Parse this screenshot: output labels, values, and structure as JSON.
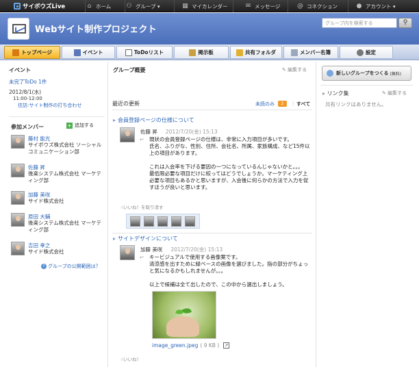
{
  "topbar": {
    "logo": "サイボウズLive",
    "nav": [
      {
        "label": "ホーム",
        "icon": "home-icon"
      },
      {
        "label": "グループ ▾",
        "icon": "group-icon"
      },
      {
        "label": "マイカレンダー",
        "icon": "calendar-icon"
      },
      {
        "label": "メッセージ",
        "icon": "message-icon"
      },
      {
        "label": "コネクション",
        "icon": "at-icon"
      },
      {
        "label": "アカウント ▾",
        "icon": "account-icon"
      }
    ]
  },
  "header": {
    "title": "Webサイト制作プロジェクト",
    "search_placeholder": "グループ内を検索する"
  },
  "tabs": [
    {
      "label": "トップページ",
      "active": true
    },
    {
      "label": "イベント"
    },
    {
      "label": "ToDoリスト"
    },
    {
      "label": "掲示板"
    },
    {
      "label": "共有フォルダ"
    },
    {
      "label": "メンバー名簿"
    },
    {
      "label": "設定"
    }
  ],
  "left": {
    "event_heading": "イベント",
    "todo_link": "未完了ToDo 1件",
    "event_date": "2012/8/1(水)",
    "event_time": "11:00-12:00",
    "event_title": "往訪:サイト制作の打ち合わせ",
    "members_heading": "参加メンバー",
    "add_label": "追加する",
    "members": [
      {
        "name": "藤村 能光",
        "org": "サイボウズ株式会社 ソーシャルコミュニケーション部"
      },
      {
        "name": "佐藤 昇",
        "org": "後楽システム株式会社 マーケティング部"
      },
      {
        "name": "加藤 美咲",
        "org": "サイド株式会社"
      },
      {
        "name": "原田 大輔",
        "org": "後楽システム株式会社 マーケティング部"
      },
      {
        "name": "吉田 孝之",
        "org": "サイド株式会社"
      }
    ],
    "scope_link": "グループの公開範囲は？"
  },
  "main": {
    "overview_heading": "グループ概要",
    "edit_label": "編集する",
    "updates_heading": "最近の更新",
    "unread_label": "未読のみ",
    "unread_count": "2",
    "all_label": "すべて",
    "posts": [
      {
        "title": "会員登録ページの仕様について",
        "author": "佐藤 昇",
        "date": "2012/7/20(金) 15:13",
        "body": "現状の会員登録ページの仕様は、非常に入力項目が多いです。\n氏名、ふりがな、性別、住所、会社名、所属、家族構成、など15件以上の項目があります。\n\nこれは入会率を下げる要因の一つになっているんじゃないかと。。。\n最低限必要な項目だけに絞ってはどうでしょうか。マーケティング上必要な項目もあるかと思いますが、入会後に何らかの方法で入力を促すほうが良いと思います。",
        "like_label": "いいね！を取り消す"
      },
      {
        "title": "サイトデザインについて",
        "author": "加藤 美咲",
        "date": "2012/7/20(金) 15:13",
        "body": "キービジュアルで使用する画像案です。\n清涼感を出すために緑ベースの画像を選びました。指の部分がちょっと気になるかもしれませんが。。。\n\n以上で候補は全て出したので、この中から選出しましょう。",
        "attachment_name": "image_green.jpeg",
        "attachment_size": "( 9 KB )",
        "like_label": "いいね！"
      }
    ]
  },
  "right": {
    "new_group_label": "新しいグループをつくる",
    "new_group_note": "(無料)",
    "links_heading": "リンク集",
    "edit_label": "編集する",
    "no_links": "共有リンクはありません。"
  }
}
